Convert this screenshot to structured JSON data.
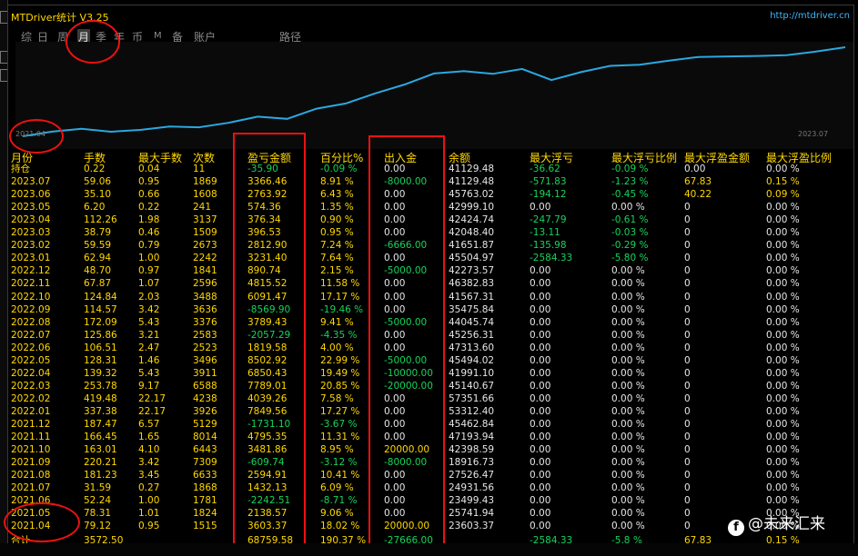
{
  "window": {
    "title": "MTDriver统计 V3.25",
    "url": "http://mtdriver.cn"
  },
  "tabs": [
    {
      "label": "综",
      "active": false
    },
    {
      "label": "日",
      "active": false
    },
    {
      "label": "周",
      "active": false
    },
    {
      "label": "月",
      "active": true
    },
    {
      "label": "季",
      "active": false
    },
    {
      "label": "年",
      "active": false
    },
    {
      "label": "币",
      "active": false
    },
    {
      "label": "M",
      "active": false
    },
    {
      "label": "备",
      "active": false
    },
    {
      "label": "账户",
      "active": false
    },
    {
      "label": "路径",
      "active": false
    }
  ],
  "chart_data": {
    "type": "line",
    "x_start_label": "2021.04",
    "x_end_label": "2023.07",
    "series_color": "#2aa8e0",
    "x": [
      "2021.04",
      "2021.05",
      "2021.06",
      "2021.07",
      "2021.08",
      "2021.09",
      "2021.10",
      "2021.11",
      "2021.12",
      "2022.01",
      "2022.02",
      "2022.03",
      "2022.04",
      "2022.05",
      "2022.06",
      "2022.07",
      "2022.08",
      "2022.09",
      "2022.10",
      "2022.11",
      "2022.12",
      "2023.01",
      "2023.02",
      "2023.03",
      "2023.04",
      "2023.05",
      "2023.06",
      "2023.07"
    ],
    "values": [
      23603.37,
      25741.94,
      23499.43,
      24931.56,
      27526.47,
      18916.73,
      42398.59,
      47193.94,
      45462.84,
      53312.4,
      57351.66,
      45140.67,
      41991.1,
      45494.02,
      47313.6,
      45256.31,
      44045.74,
      35475.84,
      41567.31,
      46382.83,
      42273.57,
      45504.97,
      41651.87,
      42048.4,
      42424.74,
      42999.1,
      45763.02,
      41129.48
    ]
  },
  "columns": [
    "月份",
    "手数",
    "最大手数",
    "次数",
    "盈亏金额",
    "百分比%",
    "出入金",
    "余额",
    "最大浮亏",
    "最大浮亏比例",
    "最大浮盈金额",
    "最大浮盈比例"
  ],
  "rows": [
    {
      "month": "持仓",
      "lots": "0.22",
      "maxlots": "0.04",
      "count": "11",
      "pnl": "-35.90",
      "pct": "-0.09 %",
      "flow": "0.00",
      "balance": "41129.48",
      "maxdd": "-36.62",
      "maxddpct": "-0.09 %",
      "maxfp": "0.00",
      "maxfppct": "0.00 %"
    },
    {
      "month": "2023.07",
      "lots": "59.06",
      "maxlots": "0.95",
      "count": "1869",
      "pnl": "3366.46",
      "pct": "8.91 %",
      "flow": "-8000.00",
      "balance": "41129.48",
      "maxdd": "-571.83",
      "maxddpct": "-1.23 %",
      "maxfp": "67.83",
      "maxfppct": "0.15 %"
    },
    {
      "month": "2023.06",
      "lots": "35.10",
      "maxlots": "0.66",
      "count": "1608",
      "pnl": "2763.92",
      "pct": "6.43 %",
      "flow": "0.00",
      "balance": "45763.02",
      "maxdd": "-194.12",
      "maxddpct": "-0.45 %",
      "maxfp": "40.22",
      "maxfppct": "0.09 %"
    },
    {
      "month": "2023.05",
      "lots": "6.20",
      "maxlots": "0.22",
      "count": "241",
      "pnl": "574.36",
      "pct": "1.35 %",
      "flow": "0.00",
      "balance": "42999.10",
      "maxdd": "0.00",
      "maxddpct": "0.00 %",
      "maxfp": "0",
      "maxfppct": "0.00 %"
    },
    {
      "month": "2023.04",
      "lots": "112.26",
      "maxlots": "1.98",
      "count": "3137",
      "pnl": "376.34",
      "pct": "0.90 %",
      "flow": "0.00",
      "balance": "42424.74",
      "maxdd": "-247.79",
      "maxddpct": "-0.61 %",
      "maxfp": "0",
      "maxfppct": "0.00 %"
    },
    {
      "month": "2023.03",
      "lots": "38.79",
      "maxlots": "0.46",
      "count": "1509",
      "pnl": "396.53",
      "pct": "0.95 %",
      "flow": "0.00",
      "balance": "42048.40",
      "maxdd": "-13.11",
      "maxddpct": "-0.03 %",
      "maxfp": "0",
      "maxfppct": "0.00 %"
    },
    {
      "month": "2023.02",
      "lots": "59.59",
      "maxlots": "0.79",
      "count": "2673",
      "pnl": "2812.90",
      "pct": "7.24 %",
      "flow": "-6666.00",
      "balance": "41651.87",
      "maxdd": "-135.98",
      "maxddpct": "-0.29 %",
      "maxfp": "0",
      "maxfppct": "0.00 %"
    },
    {
      "month": "2023.01",
      "lots": "62.94",
      "maxlots": "1.00",
      "count": "2242",
      "pnl": "3231.40",
      "pct": "7.64 %",
      "flow": "0.00",
      "balance": "45504.97",
      "maxdd": "-2584.33",
      "maxddpct": "-5.80 %",
      "maxfp": "0",
      "maxfppct": "0.00 %"
    },
    {
      "month": "2022.12",
      "lots": "48.70",
      "maxlots": "0.97",
      "count": "1841",
      "pnl": "890.74",
      "pct": "2.15 %",
      "flow": "-5000.00",
      "balance": "42273.57",
      "maxdd": "0.00",
      "maxddpct": "0.00 %",
      "maxfp": "0",
      "maxfppct": "0.00 %"
    },
    {
      "month": "2022.11",
      "lots": "67.87",
      "maxlots": "1.07",
      "count": "2596",
      "pnl": "4815.52",
      "pct": "11.58 %",
      "flow": "0.00",
      "balance": "46382.83",
      "maxdd": "0.00",
      "maxddpct": "0.00 %",
      "maxfp": "0",
      "maxfppct": "0.00 %"
    },
    {
      "month": "2022.10",
      "lots": "124.84",
      "maxlots": "2.03",
      "count": "3488",
      "pnl": "6091.47",
      "pct": "17.17 %",
      "flow": "0.00",
      "balance": "41567.31",
      "maxdd": "0.00",
      "maxddpct": "0.00 %",
      "maxfp": "0",
      "maxfppct": "0.00 %"
    },
    {
      "month": "2022.09",
      "lots": "114.57",
      "maxlots": "3.42",
      "count": "3636",
      "pnl": "-8569.90",
      "pct": "-19.46 %",
      "flow": "0.00",
      "balance": "35475.84",
      "maxdd": "0.00",
      "maxddpct": "0.00 %",
      "maxfp": "0",
      "maxfppct": "0.00 %"
    },
    {
      "month": "2022.08",
      "lots": "172.09",
      "maxlots": "5.43",
      "count": "3376",
      "pnl": "3789.43",
      "pct": "9.41 %",
      "flow": "-5000.00",
      "balance": "44045.74",
      "maxdd": "0.00",
      "maxddpct": "0.00 %",
      "maxfp": "0",
      "maxfppct": "0.00 %"
    },
    {
      "month": "2022.07",
      "lots": "125.86",
      "maxlots": "3.21",
      "count": "2583",
      "pnl": "-2057.29",
      "pct": "-4.35 %",
      "flow": "0.00",
      "balance": "45256.31",
      "maxdd": "0.00",
      "maxddpct": "0.00 %",
      "maxfp": "0",
      "maxfppct": "0.00 %"
    },
    {
      "month": "2022.06",
      "lots": "106.51",
      "maxlots": "2.47",
      "count": "2523",
      "pnl": "1819.58",
      "pct": "4.00 %",
      "flow": "0.00",
      "balance": "47313.60",
      "maxdd": "0.00",
      "maxddpct": "0.00 %",
      "maxfp": "0",
      "maxfppct": "0.00 %"
    },
    {
      "month": "2022.05",
      "lots": "128.31",
      "maxlots": "1.46",
      "count": "3496",
      "pnl": "8502.92",
      "pct": "22.99 %",
      "flow": "-5000.00",
      "balance": "45494.02",
      "maxdd": "0.00",
      "maxddpct": "0.00 %",
      "maxfp": "0",
      "maxfppct": "0.00 %"
    },
    {
      "month": "2022.04",
      "lots": "139.32",
      "maxlots": "5.43",
      "count": "3911",
      "pnl": "6850.43",
      "pct": "19.49 %",
      "flow": "-10000.00",
      "balance": "41991.10",
      "maxdd": "0.00",
      "maxddpct": "0.00 %",
      "maxfp": "0",
      "maxfppct": "0.00 %"
    },
    {
      "month": "2022.03",
      "lots": "253.78",
      "maxlots": "9.17",
      "count": "6588",
      "pnl": "7789.01",
      "pct": "20.85 %",
      "flow": "-20000.00",
      "balance": "45140.67",
      "maxdd": "0.00",
      "maxddpct": "0.00 %",
      "maxfp": "0",
      "maxfppct": "0.00 %"
    },
    {
      "month": "2022.02",
      "lots": "419.48",
      "maxlots": "22.17",
      "count": "4238",
      "pnl": "4039.26",
      "pct": "7.58 %",
      "flow": "0.00",
      "balance": "57351.66",
      "maxdd": "0.00",
      "maxddpct": "0.00 %",
      "maxfp": "0",
      "maxfppct": "0.00 %"
    },
    {
      "month": "2022.01",
      "lots": "337.38",
      "maxlots": "22.17",
      "count": "3926",
      "pnl": "7849.56",
      "pct": "17.27 %",
      "flow": "0.00",
      "balance": "53312.40",
      "maxdd": "0.00",
      "maxddpct": "0.00 %",
      "maxfp": "0",
      "maxfppct": "0.00 %"
    },
    {
      "month": "2021.12",
      "lots": "187.47",
      "maxlots": "6.57",
      "count": "5129",
      "pnl": "-1731.10",
      "pct": "-3.67 %",
      "flow": "0.00",
      "balance": "45462.84",
      "maxdd": "0.00",
      "maxddpct": "0.00 %",
      "maxfp": "0",
      "maxfppct": "0.00 %"
    },
    {
      "month": "2021.11",
      "lots": "166.45",
      "maxlots": "1.65",
      "count": "8014",
      "pnl": "4795.35",
      "pct": "11.31 %",
      "flow": "0.00",
      "balance": "47193.94",
      "maxdd": "0.00",
      "maxddpct": "0.00 %",
      "maxfp": "0",
      "maxfppct": "0.00 %"
    },
    {
      "month": "2021.10",
      "lots": "163.01",
      "maxlots": "4.10",
      "count": "6443",
      "pnl": "3481.86",
      "pct": "8.95 %",
      "flow": "20000.00",
      "balance": "42398.59",
      "maxdd": "0.00",
      "maxddpct": "0.00 %",
      "maxfp": "0",
      "maxfppct": "0.00 %"
    },
    {
      "month": "2021.09",
      "lots": "220.21",
      "maxlots": "3.42",
      "count": "7309",
      "pnl": "-609.74",
      "pct": "-3.12 %",
      "flow": "-8000.00",
      "balance": "18916.73",
      "maxdd": "0.00",
      "maxddpct": "0.00 %",
      "maxfp": "0",
      "maxfppct": "0.00 %"
    },
    {
      "month": "2021.08",
      "lots": "181.23",
      "maxlots": "3.45",
      "count": "6633",
      "pnl": "2594.91",
      "pct": "10.41 %",
      "flow": "0.00",
      "balance": "27526.47",
      "maxdd": "0.00",
      "maxddpct": "0.00 %",
      "maxfp": "0",
      "maxfppct": "0.00 %"
    },
    {
      "month": "2021.07",
      "lots": "31.59",
      "maxlots": "0.27",
      "count": "1868",
      "pnl": "1432.13",
      "pct": "6.09 %",
      "flow": "0.00",
      "balance": "24931.56",
      "maxdd": "0.00",
      "maxddpct": "0.00 %",
      "maxfp": "0",
      "maxfppct": "0.00 %"
    },
    {
      "month": "2021.06",
      "lots": "52.24",
      "maxlots": "1.00",
      "count": "1781",
      "pnl": "-2242.51",
      "pct": "-8.71 %",
      "flow": "0.00",
      "balance": "23499.43",
      "maxdd": "0.00",
      "maxddpct": "0.00 %",
      "maxfp": "0",
      "maxfppct": "0.00 %"
    },
    {
      "month": "2021.05",
      "lots": "78.31",
      "maxlots": "1.01",
      "count": "1824",
      "pnl": "2138.57",
      "pct": "9.06 %",
      "flow": "0.00",
      "balance": "25741.94",
      "maxdd": "0.00",
      "maxddpct": "0.00 %",
      "maxfp": "0",
      "maxfppct": "0.00 %"
    },
    {
      "month": "2021.04",
      "lots": "79.12",
      "maxlots": "0.95",
      "count": "1515",
      "pnl": "3603.37",
      "pct": "18.02 %",
      "flow": "20000.00",
      "balance": "23603.37",
      "maxdd": "0.00",
      "maxddpct": "0.00 %",
      "maxfp": "0",
      "maxfppct": "0.00 %"
    }
  ],
  "totals": {
    "month": "合计",
    "lots": "3572.50",
    "maxlots": "",
    "count": "",
    "pnl": "68759.58",
    "pct": "190.37 %",
    "flow": "-27666.00",
    "balance": "",
    "maxdd": "-2584.33",
    "maxddpct": "-5.8 %",
    "maxfp": "67.83",
    "maxfppct": "0.15 %"
  },
  "watermark": "@未来汇来",
  "colors": {
    "header": "#ffd800",
    "positive": "#ffd800",
    "negative": "#17d35a",
    "neutral": "#e6e6e6",
    "annotation": "#e11111"
  }
}
